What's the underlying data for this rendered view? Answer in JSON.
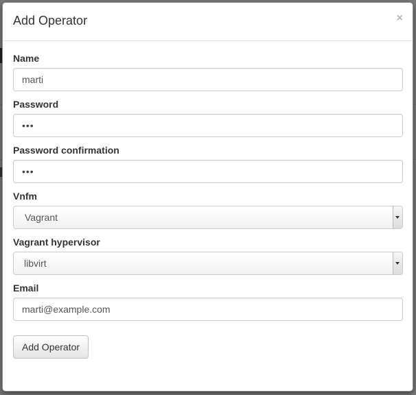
{
  "modal": {
    "title": "Add Operator",
    "close_label": "×"
  },
  "form": {
    "name": {
      "label": "Name",
      "value": "marti"
    },
    "password": {
      "label": "Password",
      "value": "•••"
    },
    "password_confirmation": {
      "label": "Password confirmation",
      "value": "•••"
    },
    "vnfm": {
      "label": "Vnfm",
      "selected": "Vagrant"
    },
    "vagrant_hypervisor": {
      "label": "Vagrant hypervisor",
      "selected": "libvirt"
    },
    "email": {
      "label": "Email",
      "value": "marti@example.com"
    },
    "submit_label": "Add Operator"
  },
  "icons": {
    "close": "close-icon",
    "select_arrow": "chevron-down-icon"
  }
}
